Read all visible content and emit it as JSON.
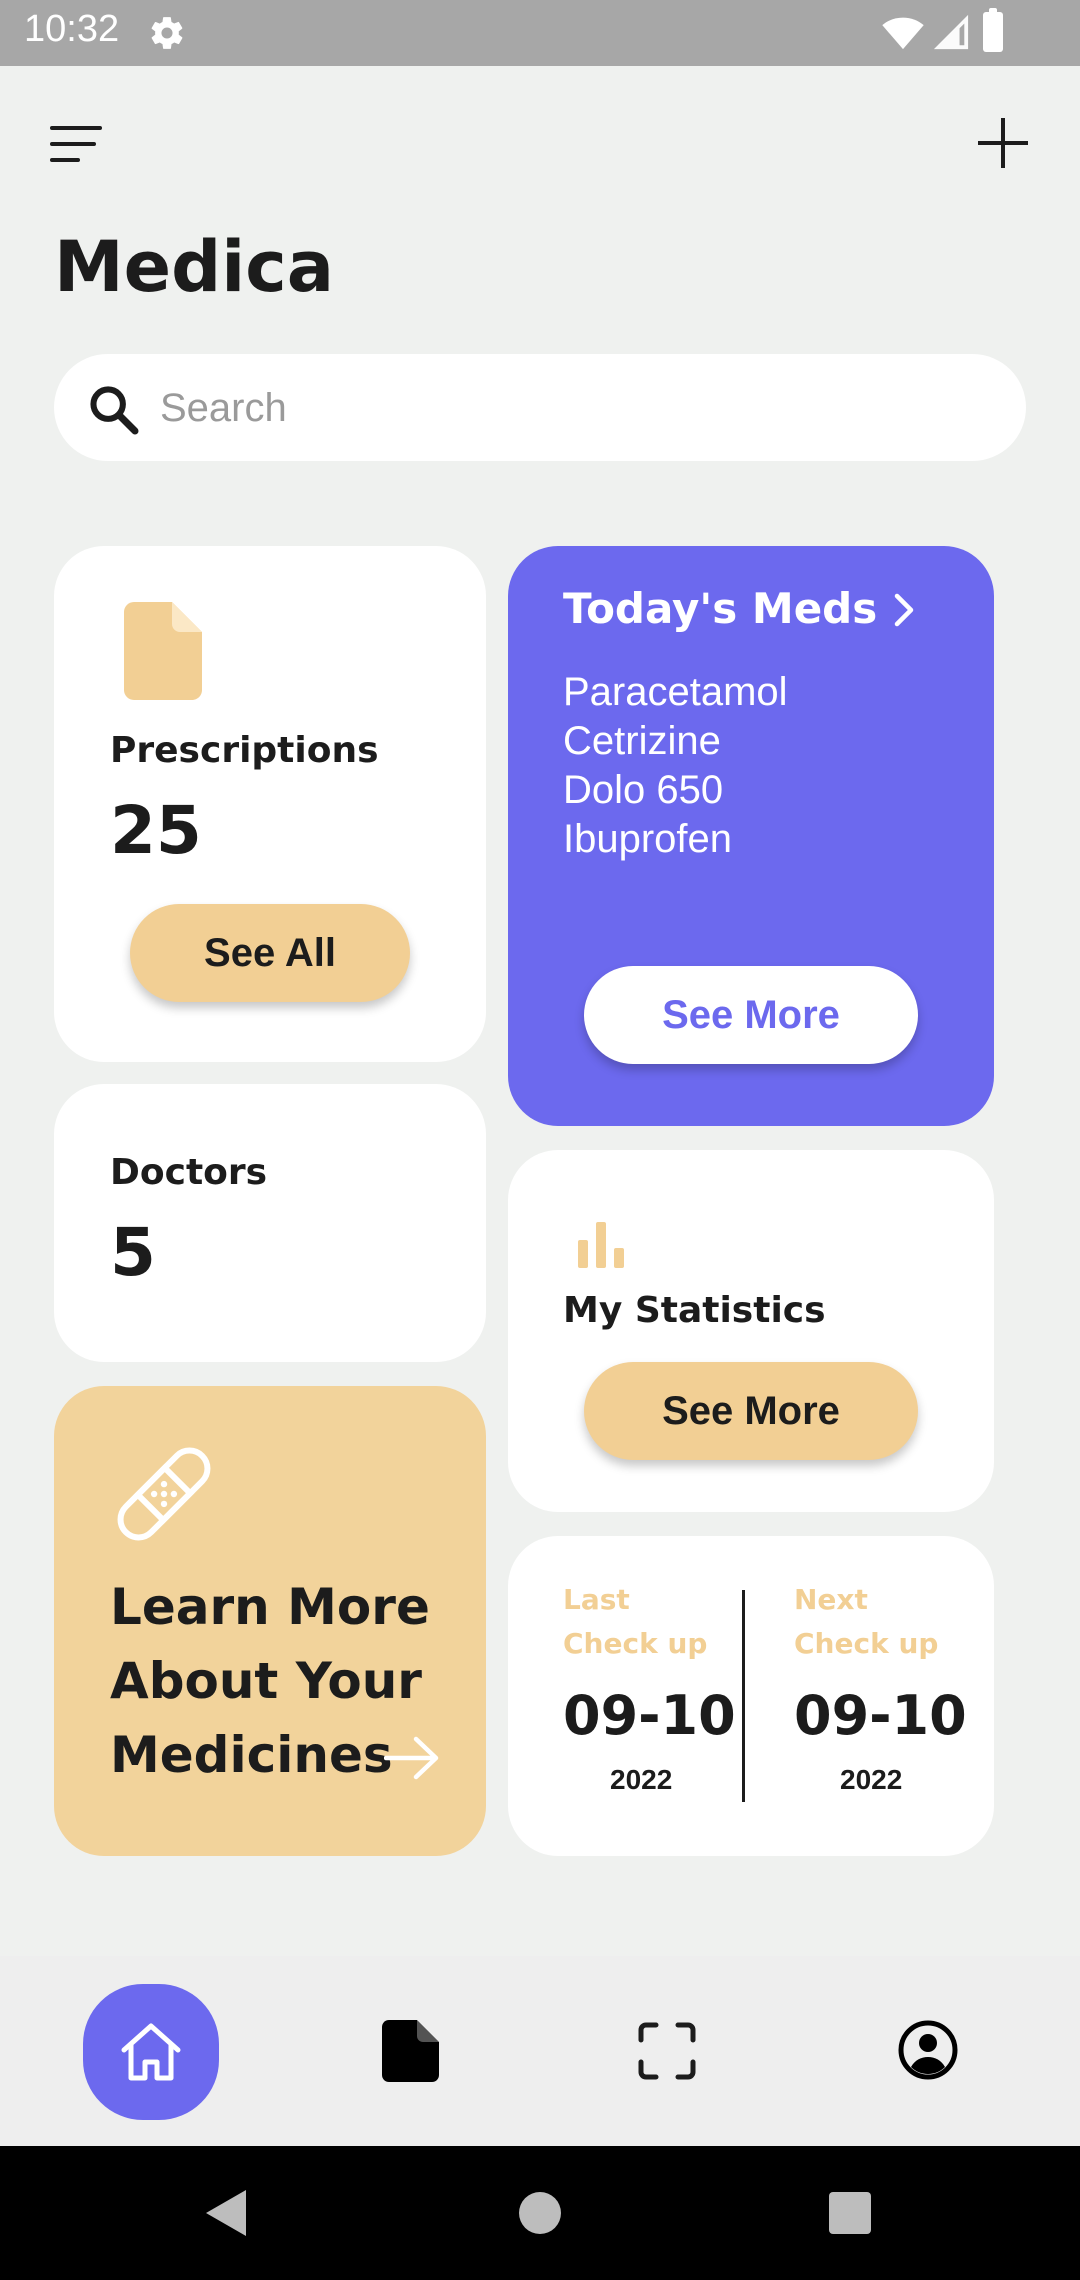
{
  "status_bar": {
    "time": "10:32"
  },
  "header": {
    "title": "Medica"
  },
  "search": {
    "placeholder": "Search",
    "value": ""
  },
  "prescriptions": {
    "label": "Prescriptions",
    "count": "25",
    "button": "See All"
  },
  "todays_meds": {
    "title": "Today's Meds",
    "items": [
      "Paracetamol",
      "Cetrizine",
      "Dolo 650",
      "Ibuprofen"
    ],
    "button": "See More"
  },
  "doctors": {
    "label": "Doctors",
    "count": "5"
  },
  "statistics": {
    "label": "My Statistics",
    "button": "See More"
  },
  "learn": {
    "lines": [
      "Learn More",
      "About Your",
      "Medicines"
    ]
  },
  "checkup": {
    "last": {
      "label_1": "Last",
      "label_2": "Check up",
      "date": "09-10",
      "year": "2022"
    },
    "next": {
      "label_1": "Next",
      "label_2": "Check up",
      "date": "09-10",
      "year": "2022"
    }
  },
  "bottom_nav": {
    "items": [
      {
        "name": "home",
        "icon": "home-icon",
        "active": true
      },
      {
        "name": "documents",
        "icon": "document-icon",
        "active": false
      },
      {
        "name": "scan",
        "icon": "scan-icon",
        "active": false
      },
      {
        "name": "profile",
        "icon": "profile-icon",
        "active": false
      }
    ]
  },
  "colors": {
    "accent": "#6c69ee",
    "sand": "#f2cf94",
    "sand_card": "#f2d39b",
    "background": "#eff1ef",
    "text": "#1c1c1c"
  }
}
